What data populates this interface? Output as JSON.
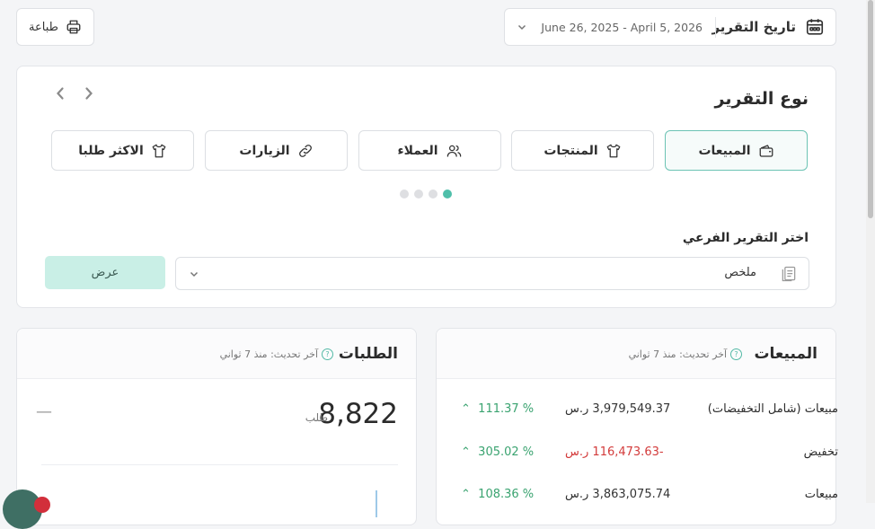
{
  "toolbar": {
    "print_label": "طباعة",
    "date_title": "تاريخ التقرير",
    "date_range": "June 26, 2025 - April 5, 2026"
  },
  "report_type": {
    "title": "نوع التقرير",
    "tabs": [
      {
        "label": "المبيعات",
        "icon": "wallet-icon",
        "active": true
      },
      {
        "label": "المنتجات",
        "icon": "shirt-icon",
        "active": false
      },
      {
        "label": "العملاء",
        "icon": "users-icon",
        "active": false
      },
      {
        "label": "الزيارات",
        "icon": "link-icon",
        "active": false
      },
      {
        "label": "الاكثر طلبا",
        "icon": "shirt-icon",
        "active": false
      }
    ],
    "sub_label": "اختر التقرير الفرعي",
    "selected": "ملخص",
    "show_label": "عرض"
  },
  "orders": {
    "title": "الطلبات",
    "updated": "آخر تحديث: منذ 7 ثواني",
    "value": "8,822",
    "unit": "طلب",
    "placeholder": "—"
  },
  "sales": {
    "title": "المبيعات",
    "updated": "آخر تحديث: منذ 7 ثواني",
    "rows": [
      {
        "label": "مبيعات (شامل التخفيضات)",
        "value": "3,979,549.37 ر.س",
        "change": "111.37 %",
        "negative": false
      },
      {
        "label": "تخفيض",
        "value": "-116,473.63 ر.س",
        "change": "305.02 %",
        "negative": true
      },
      {
        "label": "مبيعات",
        "value": "3,863,075.74 ر.س",
        "change": "108.36 %",
        "negative": false
      }
    ]
  },
  "colors": {
    "accent": "#4fbfaa",
    "negative": "#d33b3b",
    "positive": "#3aa370"
  }
}
